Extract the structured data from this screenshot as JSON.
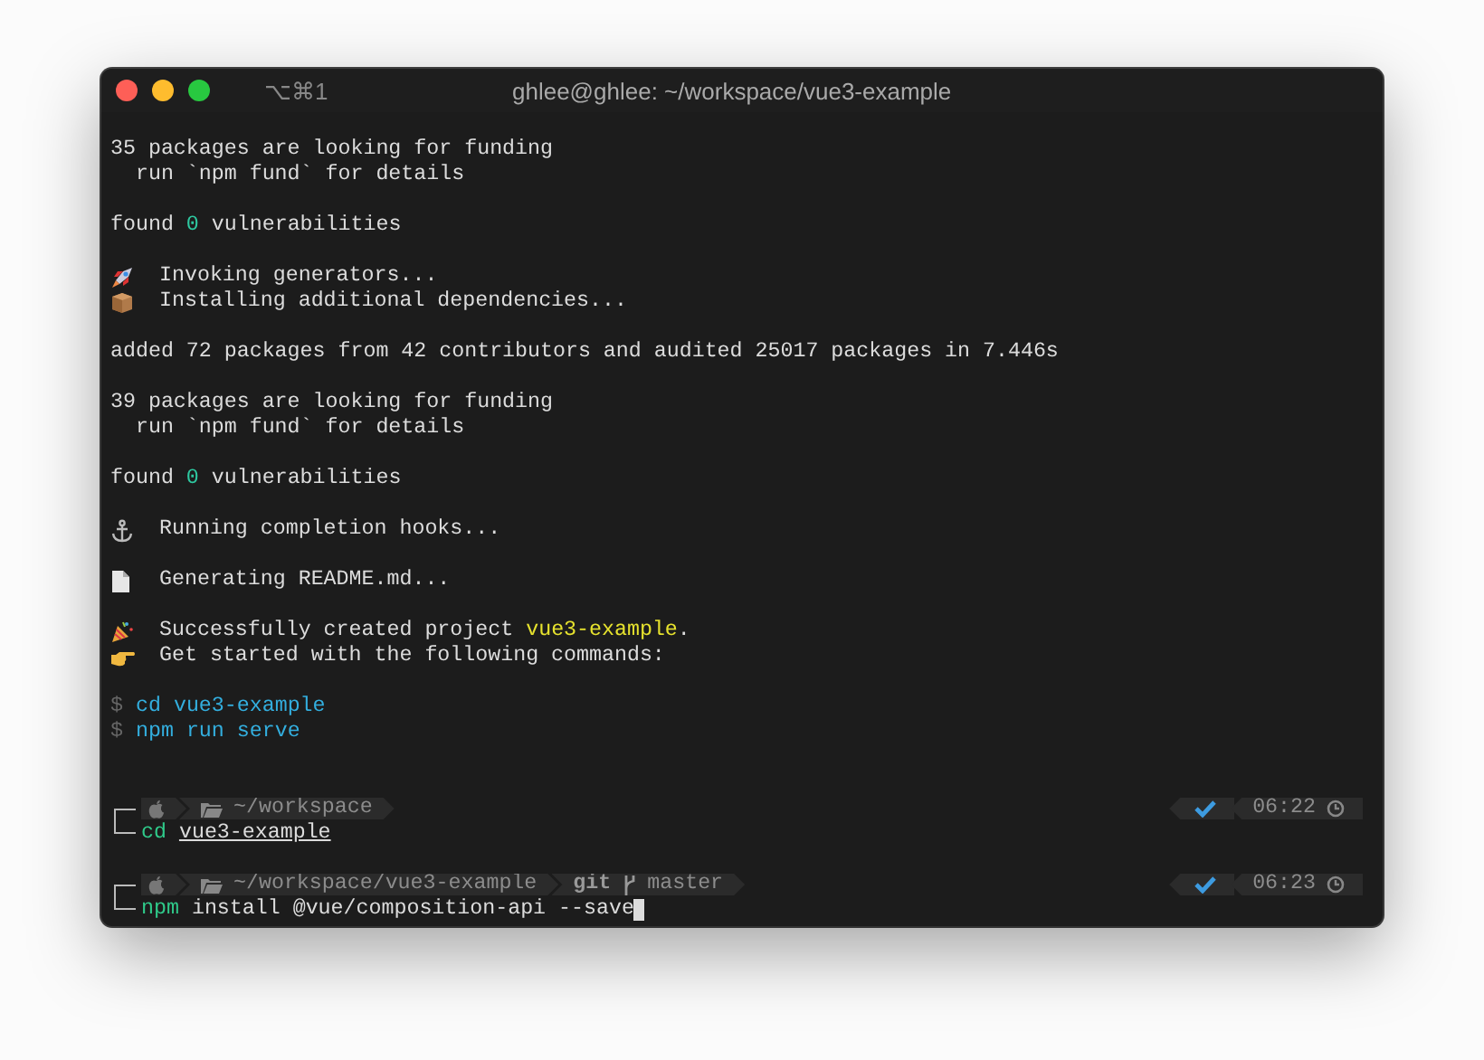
{
  "window": {
    "shortcut": "⌥⌘1",
    "title": "ghlee@ghlee: ~/workspace/vue3-example"
  },
  "lines": [
    {
      "kind": "text",
      "parts": [
        {
          "text": "35 packages are looking for funding"
        }
      ]
    },
    {
      "kind": "text",
      "parts": [
        {
          "text": "  run `npm fund` for details"
        }
      ]
    },
    {
      "kind": "blank"
    },
    {
      "kind": "text",
      "parts": [
        {
          "text": "found "
        },
        {
          "text": "0",
          "kind": "number"
        },
        {
          "text": " vulnerabilities"
        }
      ]
    },
    {
      "kind": "blank"
    },
    {
      "kind": "step",
      "parts": [
        {
          "text": "Invoking generators..."
        }
      ]
    },
    {
      "kind": "step",
      "parts": [
        {
          "text": "Installing additional dependencies..."
        }
      ]
    },
    {
      "kind": "blank"
    },
    {
      "kind": "text",
      "parts": [
        {
          "text": "added 72 packages from 42 contributors and audited 25017 packages in 7.446s"
        }
      ]
    },
    {
      "kind": "blank"
    },
    {
      "kind": "text",
      "parts": [
        {
          "text": "39 packages are looking for funding"
        }
      ]
    },
    {
      "kind": "text",
      "parts": [
        {
          "text": "  run `npm fund` for details"
        }
      ]
    },
    {
      "kind": "blank"
    },
    {
      "kind": "text",
      "parts": [
        {
          "text": "found "
        },
        {
          "text": "0",
          "kind": "number"
        },
        {
          "text": " vulnerabilities"
        }
      ]
    },
    {
      "kind": "blank"
    },
    {
      "kind": "step",
      "parts": [
        {
          "text": "Running completion hooks..."
        }
      ]
    },
    {
      "kind": "blank"
    },
    {
      "kind": "step",
      "parts": [
        {
          "text": "Generating README.md..."
        }
      ]
    },
    {
      "kind": "blank"
    },
    {
      "kind": "step",
      "parts": [
        {
          "text": "Successfully created project "
        },
        {
          "text": "vue3-example",
          "kind": "highlight"
        },
        {
          "text": "."
        }
      ]
    },
    {
      "kind": "step",
      "parts": [
        {
          "text": "Get started with the following commands:"
        }
      ]
    },
    {
      "kind": "blank"
    },
    {
      "kind": "hint",
      "prompt": "$",
      "command": "cd vue3-example"
    },
    {
      "kind": "hint",
      "prompt": "$",
      "command": "npm run serve"
    },
    {
      "kind": "blank"
    },
    {
      "kind": "blank"
    },
    {
      "kind": "prompt",
      "path": "~/workspace",
      "status_ok": true,
      "time": "06:22",
      "command": "cd",
      "args": [
        {
          "text": "vue3-example",
          "underlined": true
        }
      ],
      "cursor": false
    },
    {
      "kind": "blank"
    },
    {
      "kind": "prompt",
      "path": "~/workspace/vue3-example",
      "git": {
        "label": "git",
        "branch": "master"
      },
      "status_ok": true,
      "time": "06:23",
      "command": "npm",
      "args": [
        {
          "text": "install @vue/composition-api --save",
          "underlined": false
        }
      ],
      "cursor": true
    }
  ]
}
